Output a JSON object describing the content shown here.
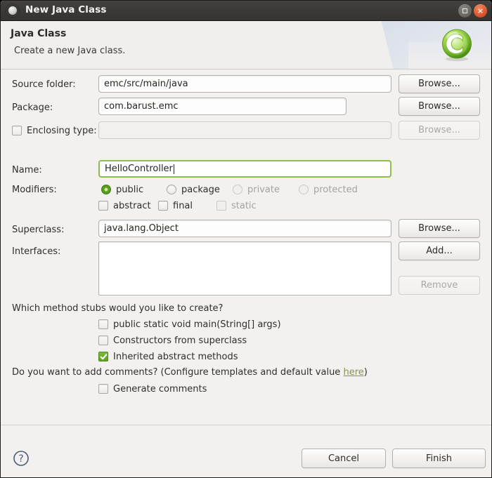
{
  "window": {
    "title": "New Java Class",
    "icon": "window-menu-icon",
    "buttons": {
      "maximize": "maximize",
      "close": "×"
    }
  },
  "header": {
    "title": "Java Class",
    "subtitle": "Create a new Java class.",
    "icon": "java-class-icon"
  },
  "form": {
    "source_folder": {
      "label": "Source folder:",
      "value": "emc/src/main/java",
      "browse": "Browse..."
    },
    "package": {
      "label": "Package:",
      "value": "com.barust.emc",
      "browse": "Browse..."
    },
    "enclosing_type": {
      "label": "Enclosing type:",
      "checked": false,
      "value": "",
      "browse": "Browse...",
      "disabled": true
    },
    "name": {
      "label": "Name:",
      "value": "HelloController",
      "focused": true
    },
    "modifiers": {
      "label": "Modifiers:",
      "access": [
        {
          "label": "public",
          "selected": true,
          "disabled": false
        },
        {
          "label": "package",
          "selected": false,
          "disabled": false
        },
        {
          "label": "private",
          "selected": false,
          "disabled": true
        },
        {
          "label": "protected",
          "selected": false,
          "disabled": true
        }
      ],
      "flags": [
        {
          "label": "abstract",
          "checked": false,
          "disabled": false
        },
        {
          "label": "final",
          "checked": false,
          "disabled": false
        },
        {
          "label": "static",
          "checked": false,
          "disabled": true
        }
      ]
    },
    "superclass": {
      "label": "Superclass:",
      "value": "java.lang.Object",
      "browse": "Browse..."
    },
    "interfaces": {
      "label": "Interfaces:",
      "items": [],
      "add": "Add...",
      "remove": "Remove",
      "remove_disabled": true
    }
  },
  "stubs": {
    "question": "Which method stubs would you like to create?",
    "options": [
      {
        "label": "public static void main(String[] args)",
        "checked": false
      },
      {
        "label": "Constructors from superclass",
        "checked": false
      },
      {
        "label": "Inherited abstract methods",
        "checked": true
      }
    ]
  },
  "comments": {
    "question_prefix": "Do you want to add comments? (Configure templates and default value ",
    "link": "here",
    "question_suffix": ")",
    "option": {
      "label": "Generate comments",
      "checked": false
    }
  },
  "footer": {
    "help": "?",
    "cancel": "Cancel",
    "finish": "Finish"
  },
  "colors": {
    "accent_green": "#61a023",
    "focus_green": "#8bbf47",
    "link": "#86924e",
    "titlebar": "#3b3936",
    "close_button": "#e2603a",
    "dialog_bg": "#f2f1f0"
  }
}
